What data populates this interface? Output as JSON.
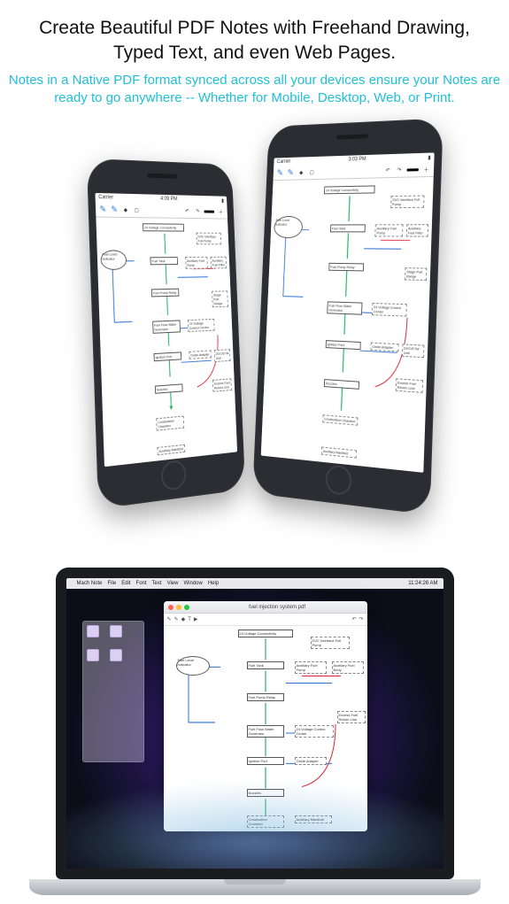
{
  "headline": "Create Beautiful PDF Notes with Freehand Drawing, Typed Text, and even Web Pages.",
  "subhead": "Notes in a Native PDF format synced across all your devices ensure your Notes are ready to go anywhere -- Whether for Mobile, Desktop, Web, or Print.",
  "phone": {
    "carrier": "Carrier",
    "time_small": "4:09 PM",
    "time_large": "3:03 PM"
  },
  "mac": {
    "menu": [
      "",
      "Mach Note",
      "File",
      "Edit",
      "Font",
      "Text",
      "View",
      "Window",
      "Help"
    ],
    "clock": "11:24:26 AM",
    "window_title": "fuel injection system.pdf"
  },
  "diagram": {
    "boxes": {
      "volt_conn": "24 Voltage Connectivity",
      "dvc": "DVC Interface Full Pump",
      "fuel_tank": "Fuel Tank",
      "aux_pump": "Auxiliary Fuel Pump",
      "aux_filter": "Auxiliary Fuel Filter",
      "aux_body": "Auxiliary Fuel Body",
      "fuel_level": "Fuel Level Indicator",
      "pump_relay": "Fuel Pump Relay",
      "gen": "Fuel Flow Water Generator",
      "volt_ctrl": "24 Voltage Control Center",
      "ignition": "Ignition Port",
      "oxide": "Oxide Adapter",
      "dvc_n": "DVC/ETM Unit",
      "nozzles": "Nozzles",
      "comb": "Combustion Chamber",
      "aux_man": "Auxiliary Manifold",
      "excess": "Excess Fuel Return Line",
      "stage1": "Stage Port Range",
      "stage2": "Stage Port Range"
    }
  }
}
